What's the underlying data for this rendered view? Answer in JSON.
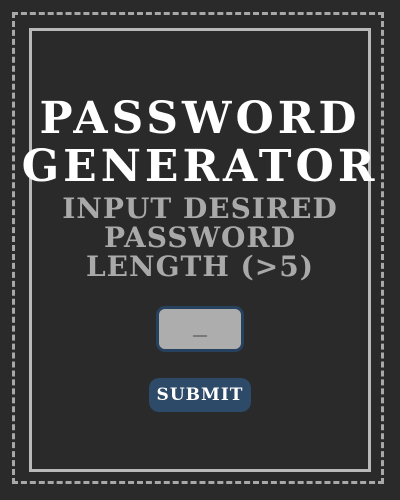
{
  "title": {
    "line1": "PASSWORD",
    "line2": "GENERATOR"
  },
  "prompt": {
    "line1": "INPUT DESIRED",
    "line2": "PASSWORD",
    "line3": "LENGTH (>5)"
  },
  "length_input": {
    "value": "",
    "placeholder": "__"
  },
  "submit_label": "SUBMIT",
  "colors": {
    "background": "#2a2a2a",
    "title_text": "#ffffff",
    "prompt_text": "#a9a9a9",
    "input_fill": "#adadad",
    "accent": "#2d4a68"
  }
}
